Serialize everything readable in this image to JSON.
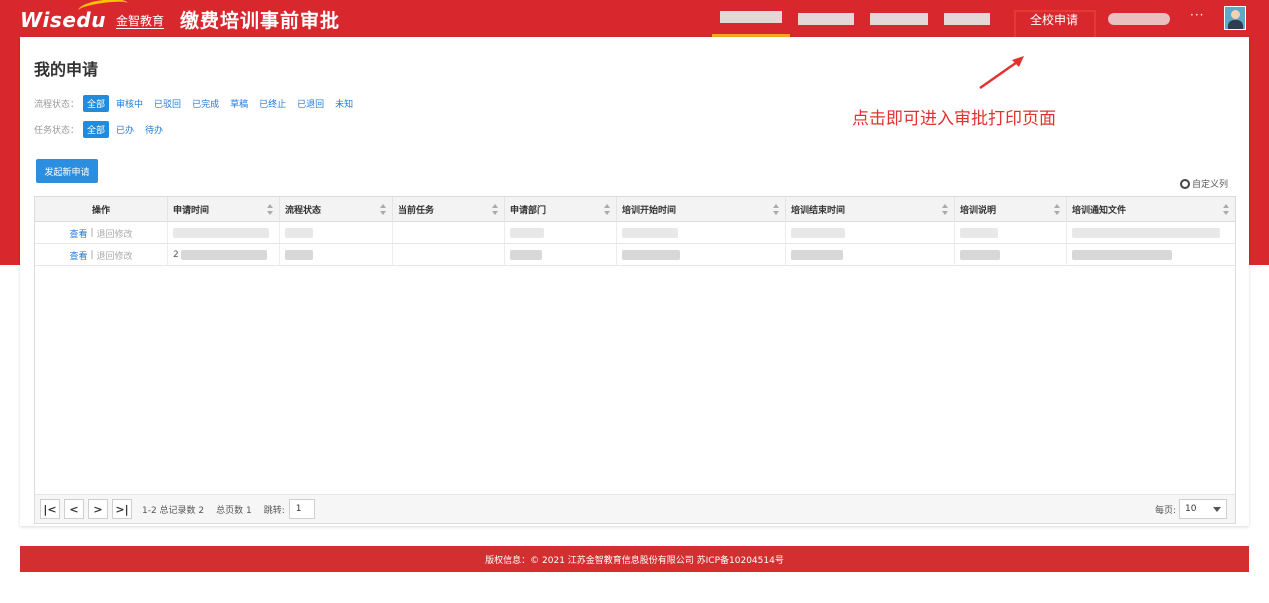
{
  "header": {
    "brand": "Wisedu",
    "brand_sub": "金智教育",
    "app_title": "缴费培训事前审批",
    "school_apply_label": "全校申请",
    "more_label": "···"
  },
  "page": {
    "title": "我的申请"
  },
  "filters": {
    "flow_status_label": "流程状态：",
    "flow_status_options": [
      "全部",
      "审核中",
      "已驳回",
      "已完成",
      "草稿",
      "已终止",
      "已退回",
      "未知"
    ],
    "task_status_label": "任务状态：",
    "task_status_options": [
      "全部",
      "已办",
      "待办"
    ]
  },
  "toolbar": {
    "new_apply_label": "发起新申请",
    "custom_columns_label": "自定义列"
  },
  "table": {
    "columns": [
      "操作",
      "申请时间",
      "流程状态",
      "当前任务",
      "申请部门",
      "培训开始时间",
      "培训结束时间",
      "培训说明",
      "培训通知文件"
    ],
    "rows": [
      {
        "view": "查看",
        "sep": "|",
        "back": "退回修改",
        "lead": ""
      },
      {
        "view": "查看",
        "sep": "|",
        "back": "退回修改",
        "lead": "2"
      }
    ]
  },
  "pager": {
    "first": "|<",
    "prev": "<",
    "next": ">",
    "last": ">|",
    "summary": "1-2 总记录数 2",
    "total_pages": "总页数 1",
    "jump_label": "跳转:",
    "jump_value": "1",
    "per_page_label": "每页:",
    "per_page_value": "10"
  },
  "annotation": {
    "text": "点击即可进入审批打印页面"
  },
  "footer": {
    "text": "版权信息：© 2021 江苏金智教育信息股份有限公司 苏ICP备10204514号"
  },
  "colors": {
    "brand_red": "#d8282e",
    "link_blue": "#1e7bd8",
    "button_blue": "#2b8ee1",
    "annotation_red": "#e3322e",
    "nav_active_underline": "#f7a823"
  }
}
